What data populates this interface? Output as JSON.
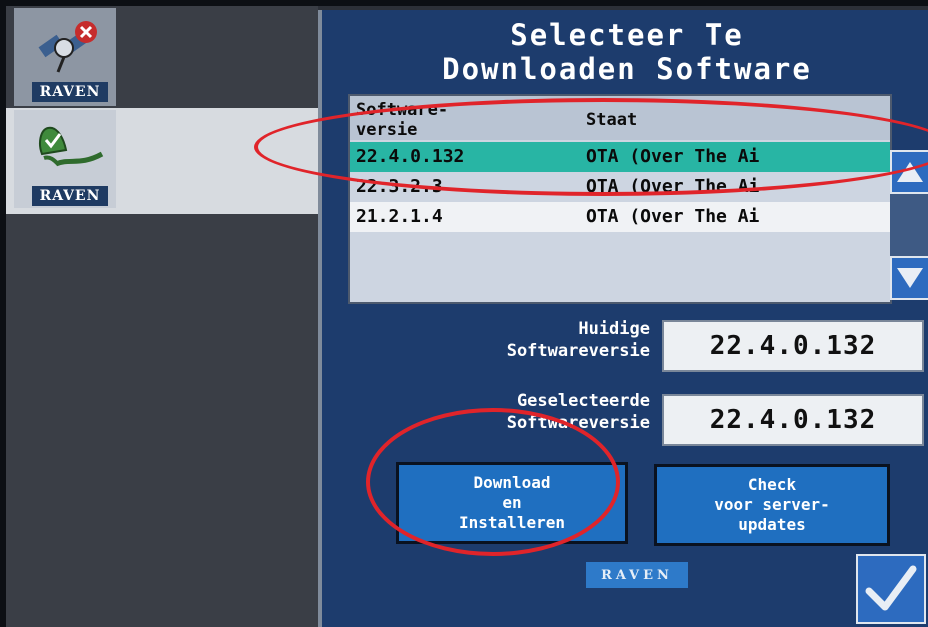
{
  "left_bar": {
    "apps": [
      {
        "brand": "RAVEN",
        "icon": "satellite-icon",
        "status_icon": "x-badge-icon"
      },
      {
        "brand": "RAVEN",
        "icon": "bell-check-icon"
      }
    ]
  },
  "dialog": {
    "title": "Selecteer Te\nDownloaden Software",
    "list": {
      "headers": [
        "Software-\nversie",
        "Staat"
      ],
      "rows": [
        {
          "version": "22.4.0.132",
          "status": "OTA (Over The Ai",
          "selected": true
        },
        {
          "version": "22.3.2.3",
          "status": "OTA (Over The Ai",
          "selected": false
        },
        {
          "version": "21.2.1.4",
          "status": "OTA (Over The Ai",
          "selected": false
        }
      ]
    },
    "current_label": "Huidige\nSoftwareversie",
    "current_value": "22.4.0.132",
    "selected_label": "Geselecteerde\nSoftwareversie",
    "selected_value": "22.4.0.132",
    "download_button": "Download\nen\nInstalleren",
    "check_button": "Check\nvoor server-\nupdates",
    "footer_logo": "RAVEN",
    "confirm_icon": "checkmark-icon"
  },
  "colors": {
    "dialog_bg": "#1d3c6d",
    "selected_row": "#28b5a4",
    "button_blue": "#1f6fc0",
    "annotation_red": "#e0242a"
  }
}
